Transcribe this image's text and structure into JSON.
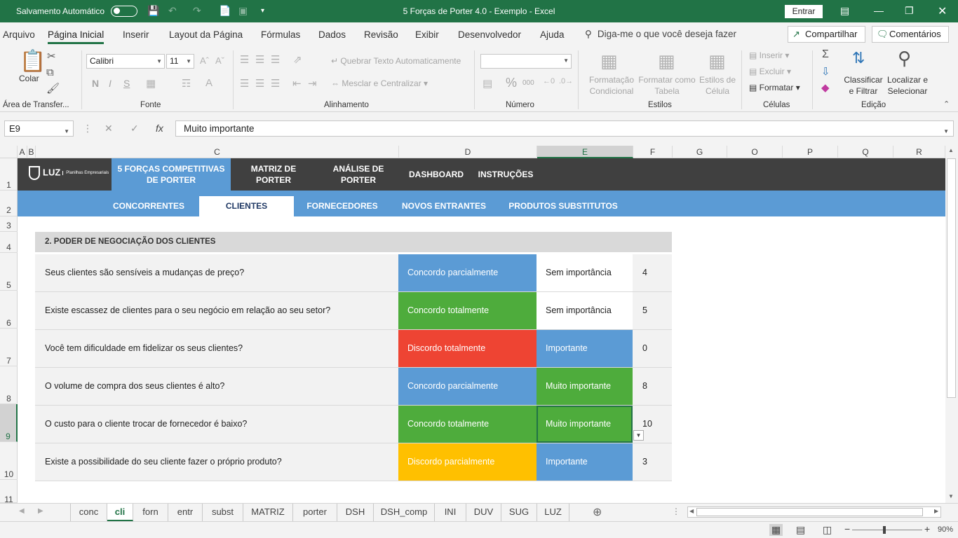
{
  "titlebar": {
    "autosave_label": "Salvamento Automático",
    "document_title": "5 Forças de Porter 4.0 - Exemplo  -  Excel",
    "signin_label": "Entrar"
  },
  "menu": {
    "tabs": [
      "Arquivo",
      "Página Inicial",
      "Inserir",
      "Layout da Página",
      "Fórmulas",
      "Dados",
      "Revisão",
      "Exibir",
      "Desenvolvedor",
      "Ajuda"
    ],
    "tellme": "Diga-me o que você deseja fazer",
    "share": "Compartilhar",
    "comments": "Comentários"
  },
  "ribbon": {
    "clipboard": {
      "paste": "Colar",
      "group": "Área de Transfer..."
    },
    "font": {
      "name": "Calibri",
      "size": "11",
      "group": "Fonte",
      "bold": "N",
      "italic": "I",
      "underline": "S"
    },
    "alignment": {
      "wrap": "Quebrar Texto Automaticamente",
      "merge": "Mesclar e Centralizar",
      "group": "Alinhamento"
    },
    "number": {
      "group": "Número",
      "percent": "%",
      "thousands": "000"
    },
    "styles": {
      "conditional": "Formatação Condicional",
      "table": "Formatar como Tabela",
      "cell": "Estilos de Célula",
      "group": "Estilos"
    },
    "cells": {
      "insert": "Inserir",
      "delete": "Excluir",
      "format": "Formatar",
      "group": "Células"
    },
    "editing": {
      "sort": "Classificar e Filtrar",
      "find": "Localizar e Selecionar",
      "group": "Edição"
    }
  },
  "formula": {
    "name_box": "E9",
    "fx": "fx",
    "value": "Muito importante"
  },
  "columns": [
    "A",
    "B",
    "C",
    "D",
    "E",
    "F",
    "G",
    "O",
    "P",
    "Q",
    "R"
  ],
  "rows": [
    "1",
    "2",
    "3",
    "4",
    "5",
    "6",
    "7",
    "8",
    "9",
    "10",
    "11"
  ],
  "nav": {
    "logo": "LUZ",
    "logo_sub": "Planilhas Empresariais",
    "items": [
      "5 FORÇAS COMPETITIVAS DE PORTER",
      "MATRIZ DE PORTER",
      "ANÁLISE DE PORTER",
      "DASHBOARD",
      "INSTRUÇÕES"
    ],
    "subitems": [
      "CONCORRENTES",
      "CLIENTES",
      "FORNECEDORES",
      "NOVOS ENTRANTES",
      "PRODUTOS SUBSTITUTOS"
    ]
  },
  "section_title": "2. PODER DE NEGOCIAÇÃO DOS CLIENTES",
  "questions": [
    {
      "q": "Seus clientes são sensíveis a mudanças de preço?",
      "answer": "Concordo parcialmente",
      "answer_color": "#5b9bd5",
      "importance": "Sem importância",
      "imp_color": "#ffffff",
      "imp_text": "#222222",
      "score": "4"
    },
    {
      "q": "Existe escassez de clientes para o seu negócio em relação ao seu setor?",
      "answer": "Concordo totalmente",
      "answer_color": "#4eac3c",
      "importance": "Sem importância",
      "imp_color": "#ffffff",
      "imp_text": "#222222",
      "score": "5"
    },
    {
      "q": "Você tem dificuldade em fidelizar os seus clientes?",
      "answer": "Discordo totalmente",
      "answer_color": "#ee4433",
      "importance": "Importante",
      "imp_color": "#5b9bd5",
      "imp_text": "#ffffff",
      "score": "0"
    },
    {
      "q": "O volume de compra dos seus clientes é alto?",
      "answer": "Concordo parcialmente",
      "answer_color": "#5b9bd5",
      "importance": "Muito importante",
      "imp_color": "#4eac3c",
      "imp_text": "#ffffff",
      "score": "8"
    },
    {
      "q": "O custo para o cliente trocar de fornecedor é baixo?",
      "answer": "Concordo totalmente",
      "answer_color": "#4eac3c",
      "importance": "Muito importante",
      "imp_color": "#4eac3c",
      "imp_text": "#ffffff",
      "score": "10"
    },
    {
      "q": "Existe a possibilidade do seu cliente fazer o próprio produto?",
      "answer": "Discordo parcialmente",
      "answer_color": "#ffc000",
      "importance": "Importante",
      "imp_color": "#5b9bd5",
      "imp_text": "#ffffff",
      "score": "3"
    }
  ],
  "sheet_tabs": [
    "conc",
    "cli",
    "forn",
    "entr",
    "subst",
    "MATRIZ",
    "porter",
    "DSH",
    "DSH_comp",
    "INI",
    "DUV",
    "SUG",
    "LUZ"
  ],
  "active_sheet": "cli",
  "status": {
    "zoom": "90%"
  },
  "colors": {
    "excel_green": "#217346",
    "nav_dark": "#404040",
    "nav_blue": "#5b9bd5"
  }
}
